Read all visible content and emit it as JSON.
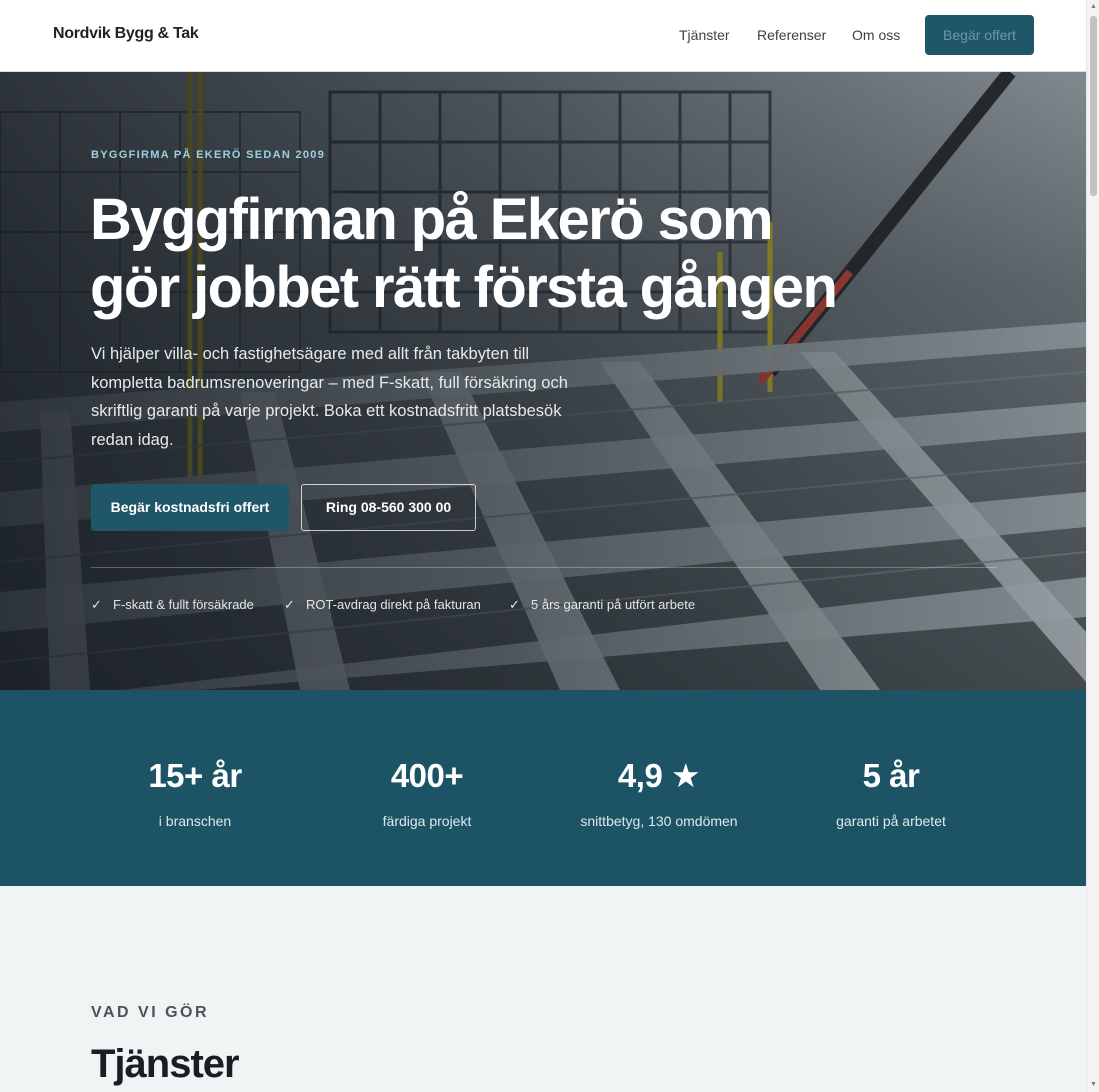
{
  "header": {
    "logo": "Nordvik Bygg & Tak",
    "nav": [
      "Tjänster",
      "Referenser",
      "Om oss"
    ],
    "cta": "Begär offert"
  },
  "hero": {
    "eyebrow": "BYGGFIRMA PÅ EKERÖ SEDAN 2009",
    "title_line1": "Byggfirman på Ekerö som",
    "title_line2": "gör jobbet rätt första gången",
    "text": "Vi hjälper villa- och fastighetsägare med allt från takbyten till kompletta badrumsrenoveringar – med F-skatt, full försäkring och skriftlig garanti på varje projekt. Boka ett kostnadsfritt platsbesök redan idag.",
    "primary_button": "Begär kostnadsfri offert",
    "secondary_button": "Ring 08-560 300 00",
    "checks": [
      "F-skatt & fullt försäkrade",
      "ROT-avdrag direkt på fakturan",
      "5 års garanti på utfört arbete"
    ]
  },
  "stats": [
    {
      "value": "15+ år",
      "label": "i branschen"
    },
    {
      "value": "400+",
      "label": "färdiga projekt"
    },
    {
      "value": "4,9 ★",
      "label": "snittbetyg, 130 omdömen"
    },
    {
      "value": "5 år",
      "label": "garanti på arbetet"
    }
  ],
  "services": {
    "eyebrow": "VAD VI GÖR",
    "title": "Tjänster"
  },
  "colors": {
    "brand": "#1f5668",
    "stats_bg": "#1c5466",
    "eyebrow": "#9cd0df",
    "page_bg": "#f0f4f5"
  },
  "icons": [
    "check-icon",
    "star-icon"
  ]
}
